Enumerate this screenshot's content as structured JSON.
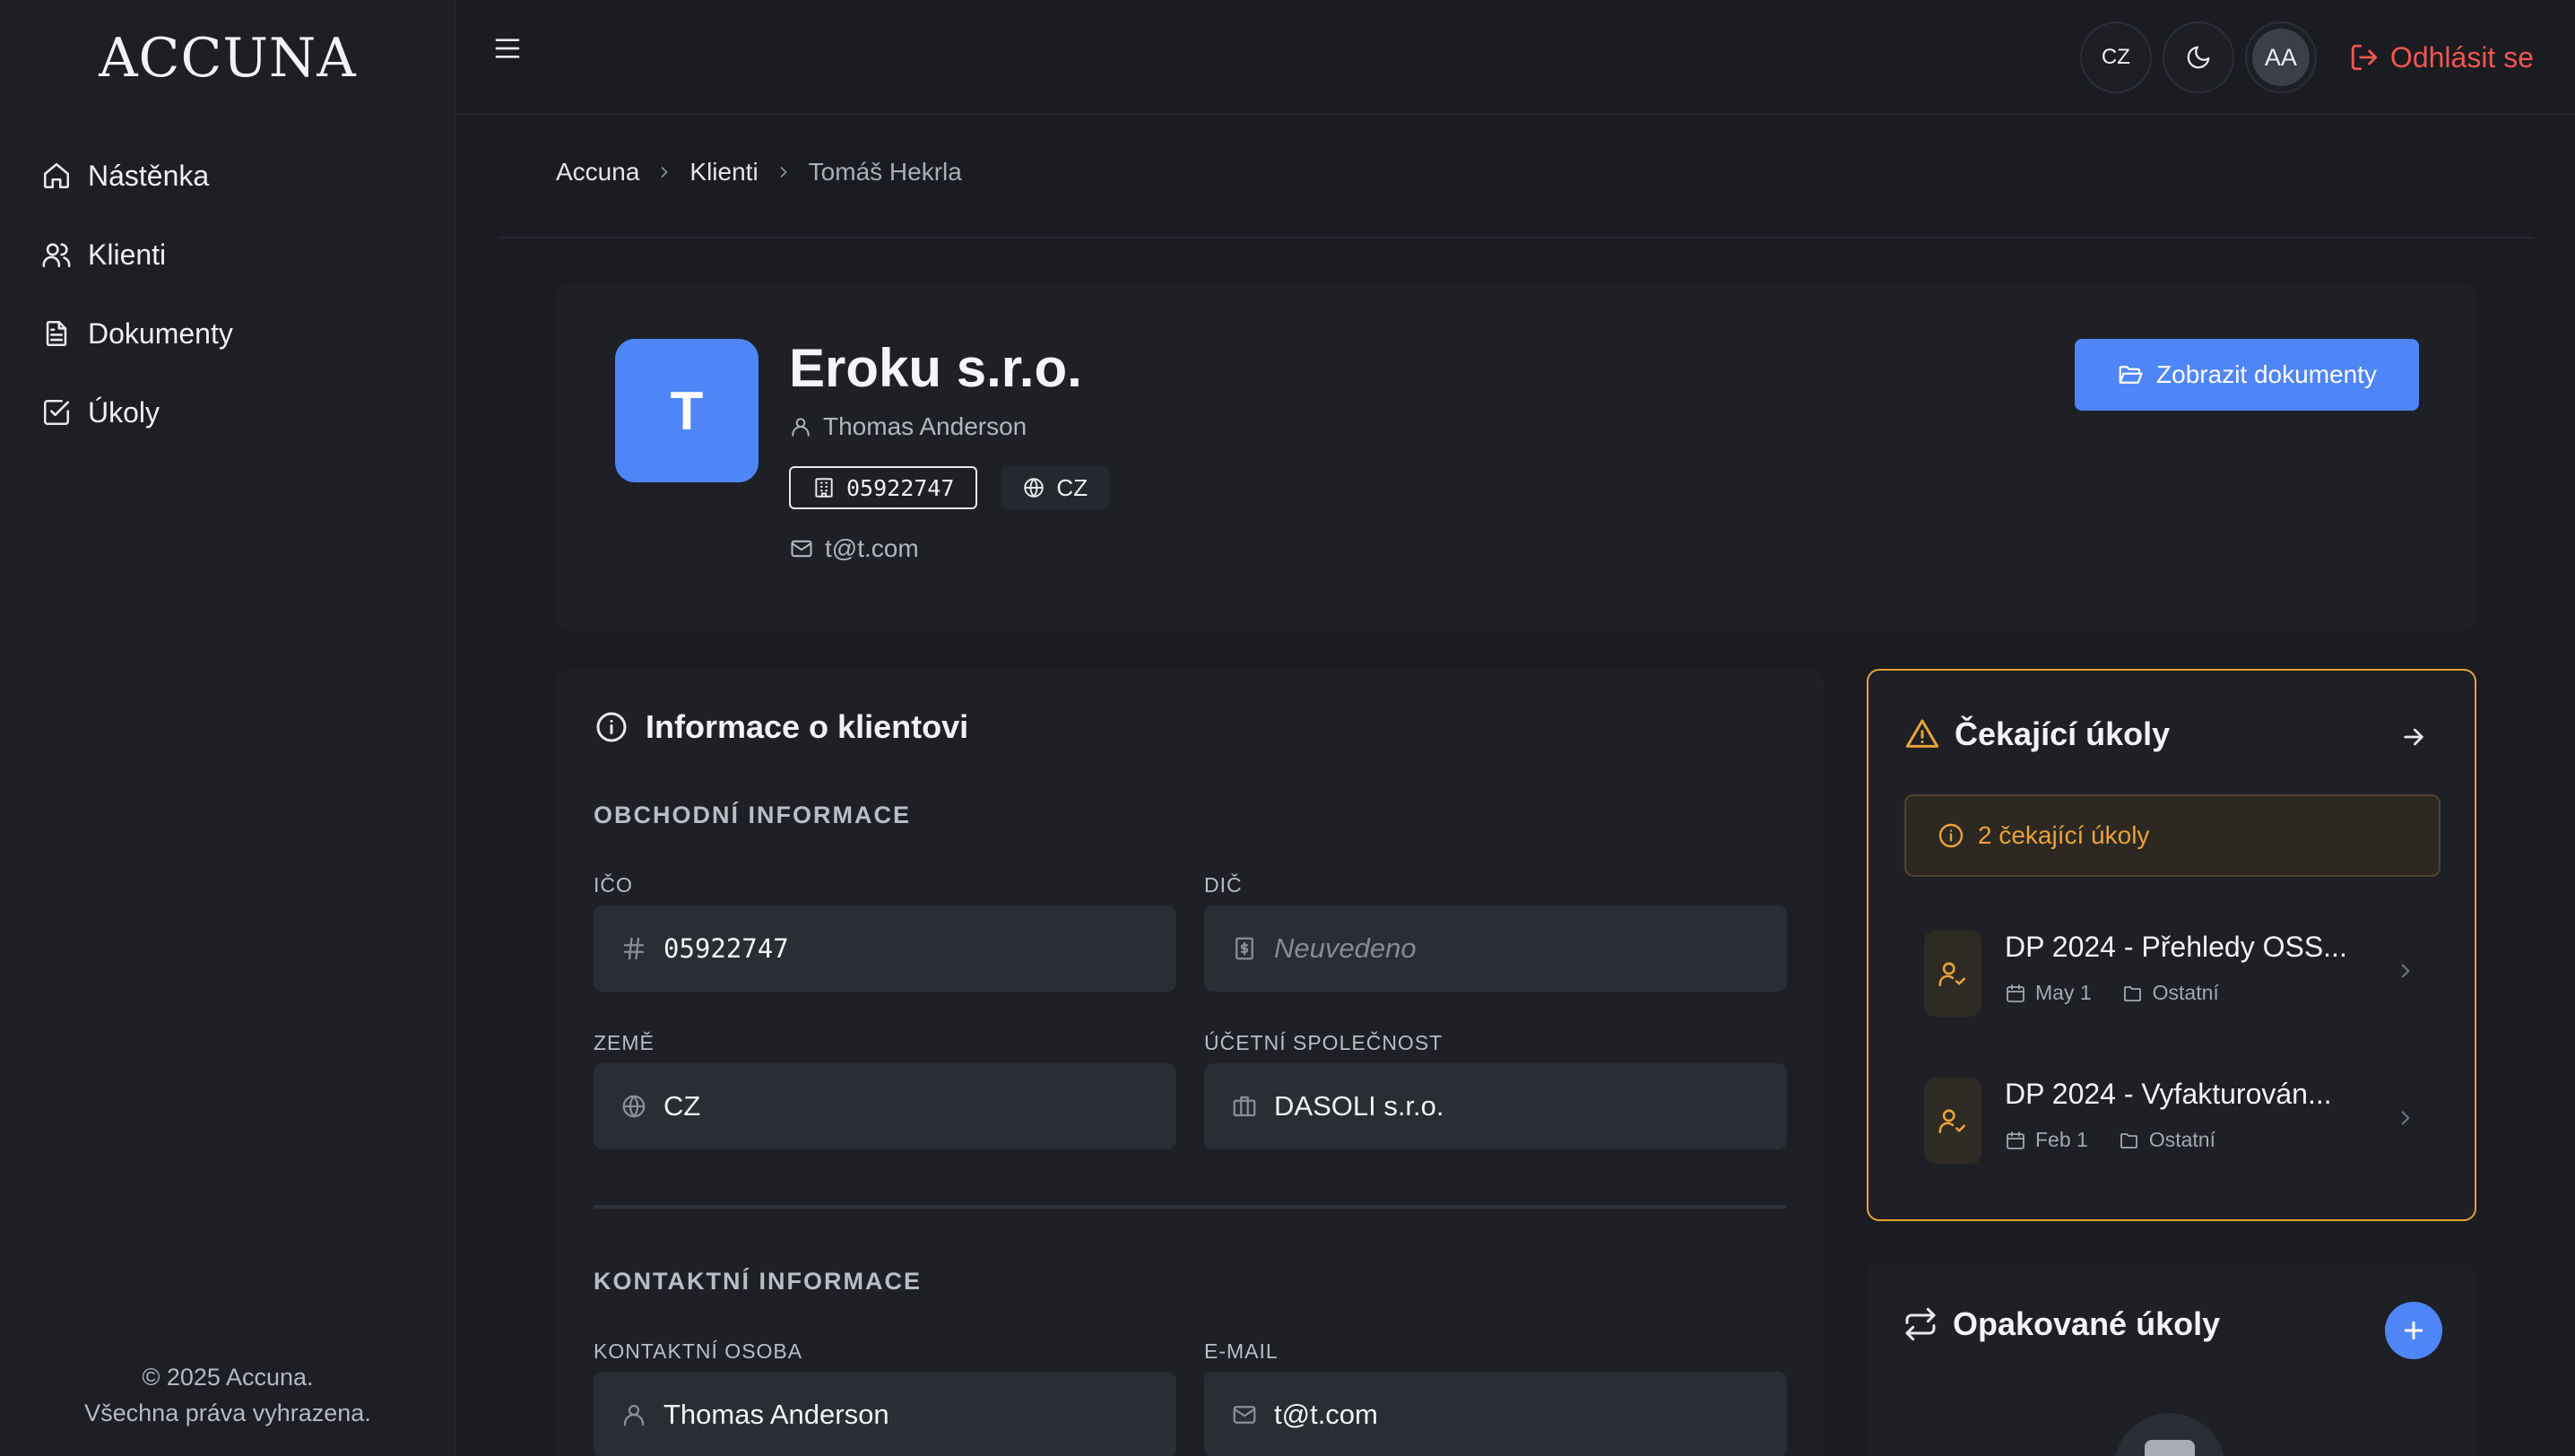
{
  "app": {
    "logo": "ACCUNA"
  },
  "sidebar": {
    "items": [
      {
        "label": "Nástěnka",
        "icon": "home-icon"
      },
      {
        "label": "Klienti",
        "icon": "users-icon"
      },
      {
        "label": "Dokumenty",
        "icon": "document-icon"
      },
      {
        "label": "Úkoly",
        "icon": "checkbox-icon"
      }
    ],
    "copyright_line1": "© 2025 Accuna.",
    "copyright_line2": "Všechna práva vyhrazena."
  },
  "topbar": {
    "language": "CZ",
    "user_initials": "AA",
    "logout_label": "Odhlásit se"
  },
  "breadcrumb": [
    "Accuna",
    "Klienti",
    "Tomáš Hekrla"
  ],
  "client": {
    "avatar_letter": "T",
    "name": "Eroku s.r.o.",
    "contact_person": "Thomas Anderson",
    "ico": "05922747",
    "country": "CZ",
    "email": "t@t.com",
    "documents_button": "Zobrazit dokumenty"
  },
  "info": {
    "title": "Informace o klientovi",
    "business_section": "OBCHODNÍ INFORMACE",
    "fields": {
      "ico_label": "IČO",
      "ico_value": "05922747",
      "dic_label": "DIČ",
      "dic_value": "Neuvedeno",
      "country_label": "ZEMĚ",
      "country_value": "CZ",
      "accounting_label": "ÚČETNÍ SPOLEČNOST",
      "accounting_value": "DASOLI s.r.o."
    },
    "contact_section": "KONTAKTNÍ INFORMACE",
    "contact_fields": {
      "person_label": "KONTAKTNÍ OSOBA",
      "person_value": "Thomas Anderson",
      "email_label": "E-MAIL",
      "email_value": "t@t.com"
    }
  },
  "pending": {
    "title": "Čekající úkoly",
    "banner": "2 čekající úkoly",
    "tasks": [
      {
        "title": "DP 2024 - Přehledy OSS...",
        "date": "May 1",
        "category": "Ostatní"
      },
      {
        "title": "DP 2024 - Vyfakturován...",
        "date": "Feb 1",
        "category": "Ostatní"
      }
    ]
  },
  "recurring": {
    "title": "Opakované úkoly"
  },
  "colors": {
    "accent": "#4f86f7",
    "warning": "#e9a23b",
    "danger": "#f0564f",
    "background": "#1a1c21"
  }
}
